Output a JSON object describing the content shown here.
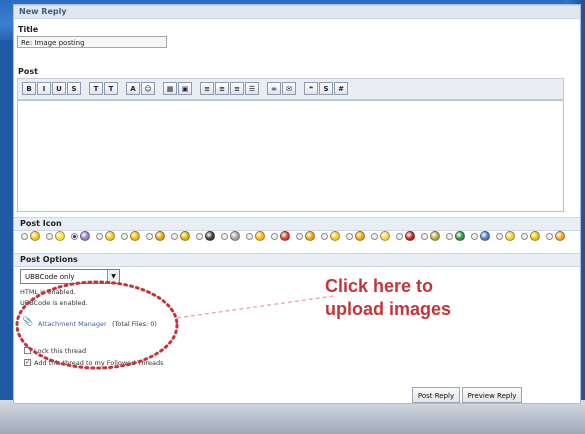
{
  "section_title": "New Reply",
  "title_label": "Title",
  "title_value": "Re: Image posting",
  "post_label": "Post",
  "toolbar": [
    {
      "icon": "bold-icon",
      "glyph": "B"
    },
    {
      "icon": "italic-icon",
      "glyph": "I"
    },
    {
      "icon": "underline-icon",
      "glyph": "U"
    },
    {
      "icon": "strikethrough-icon",
      "glyph": "S"
    },
    {
      "icon": "font-size-icon",
      "glyph": "T"
    },
    {
      "icon": "font-face-icon",
      "glyph": "T"
    },
    {
      "icon": "color-icon",
      "glyph": "A"
    },
    {
      "icon": "smiley-icon",
      "glyph": "☺"
    },
    {
      "icon": "image-icon",
      "glyph": "▦"
    },
    {
      "icon": "video-icon",
      "glyph": "▣"
    },
    {
      "icon": "align-left-icon",
      "glyph": "≡"
    },
    {
      "icon": "align-center-icon",
      "glyph": "≡"
    },
    {
      "icon": "align-right-icon",
      "glyph": "≡"
    },
    {
      "icon": "list-icon",
      "glyph": "☰"
    },
    {
      "icon": "link-icon",
      "glyph": "∞"
    },
    {
      "icon": "email-icon",
      "glyph": "✉"
    },
    {
      "icon": "quote-icon",
      "glyph": "❝"
    },
    {
      "icon": "spoiler-icon",
      "glyph": "S"
    },
    {
      "icon": "code-icon",
      "glyph": "#"
    }
  ],
  "post_icon_label": "Post Icon",
  "post_icons": [
    "#f5c518",
    "#ffdd33",
    "#8d7cc9",
    "#f0c020",
    "#f2b600",
    "#e0a000",
    "#d8b000",
    "#3c3c3c",
    "#a0a0a0",
    "#ffb300",
    "#d23c2a",
    "#e8a500",
    "#f7c81e",
    "#f29f05",
    "#f3d34a",
    "#c41f1f",
    "#b8a33a",
    "#2f8f3a",
    "#4a78c8",
    "#f2cc2a",
    "#e6c200",
    "#f0a020"
  ],
  "post_options_label": "Post Options",
  "markup_select_value": "UBBCode only",
  "html_status": "HTML is enabled.",
  "ubbcode_status": "UBBCode is enabled.",
  "attachment_link": "Attachment Manager",
  "attachment_info": "(Total Files: 0)",
  "lock_thread_label": "Lock this thread",
  "follow_thread_label": "Add this thread to my Followed Threads",
  "post_reply_label": "Post Reply",
  "preview_reply_label": "Preview Reply",
  "callout_line1": "Click here to",
  "callout_line2": "upload images",
  "callout_color": "#c4353b"
}
